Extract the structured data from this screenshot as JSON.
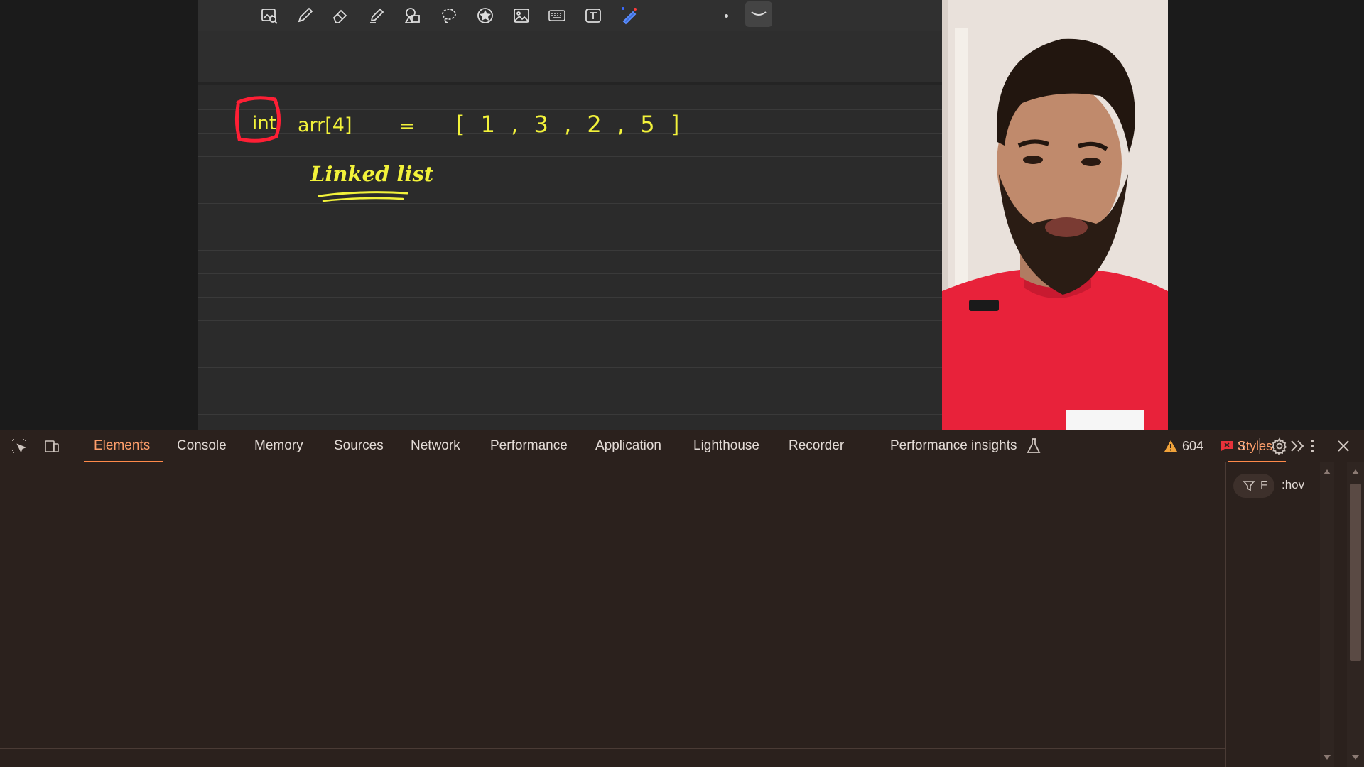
{
  "whiteboard": {
    "toolbar_tools": [
      "image-search-icon",
      "pen-icon",
      "eraser-icon",
      "highlighter-icon",
      "shapes-icon",
      "lasso-icon",
      "star-icon",
      "image-icon",
      "keyboard-icon",
      "text-box-icon",
      "laser-pointer-icon"
    ],
    "handwriting": {
      "line1_boxed": "int",
      "line1_rest": "arr[4]",
      "equals": "=",
      "array_values": "[ 1 , 3 , 2 , 5 ]",
      "line2": "Linked list"
    },
    "ink_colors": {
      "text": "#f2f23a",
      "box": "#ff1f35"
    }
  },
  "devtools": {
    "tabs": [
      {
        "label": "Elements",
        "active": true
      },
      {
        "label": "Console",
        "active": false
      },
      {
        "label": "Memory",
        "active": false
      },
      {
        "label": "Sources",
        "active": false
      },
      {
        "label": "Network",
        "active": false
      },
      {
        "label": "Performance",
        "active": false
      },
      {
        "label": "Application",
        "active": false
      },
      {
        "label": "Lighthouse",
        "active": false
      },
      {
        "label": "Recorder",
        "active": false
      },
      {
        "label": "Performance insights",
        "active": false
      }
    ],
    "warnings_count": "604",
    "errors_count": "3",
    "styles_tab": "Styles",
    "filter_placeholder": "F",
    "hov_label": ":hov",
    "overflow_dot": ".",
    "accent": "#ff8a4a"
  }
}
